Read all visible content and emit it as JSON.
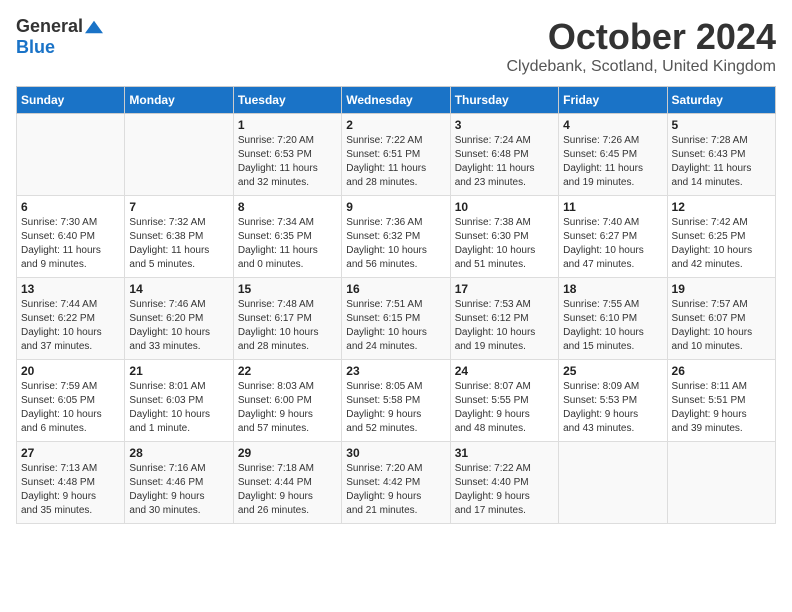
{
  "header": {
    "logo_general": "General",
    "logo_blue": "Blue",
    "month_title": "October 2024",
    "location": "Clydebank, Scotland, United Kingdom"
  },
  "days_of_week": [
    "Sunday",
    "Monday",
    "Tuesday",
    "Wednesday",
    "Thursday",
    "Friday",
    "Saturday"
  ],
  "weeks": [
    [
      {
        "day": "",
        "info": ""
      },
      {
        "day": "",
        "info": ""
      },
      {
        "day": "1",
        "info": "Sunrise: 7:20 AM\nSunset: 6:53 PM\nDaylight: 11 hours\nand 32 minutes."
      },
      {
        "day": "2",
        "info": "Sunrise: 7:22 AM\nSunset: 6:51 PM\nDaylight: 11 hours\nand 28 minutes."
      },
      {
        "day": "3",
        "info": "Sunrise: 7:24 AM\nSunset: 6:48 PM\nDaylight: 11 hours\nand 23 minutes."
      },
      {
        "day": "4",
        "info": "Sunrise: 7:26 AM\nSunset: 6:45 PM\nDaylight: 11 hours\nand 19 minutes."
      },
      {
        "day": "5",
        "info": "Sunrise: 7:28 AM\nSunset: 6:43 PM\nDaylight: 11 hours\nand 14 minutes."
      }
    ],
    [
      {
        "day": "6",
        "info": "Sunrise: 7:30 AM\nSunset: 6:40 PM\nDaylight: 11 hours\nand 9 minutes."
      },
      {
        "day": "7",
        "info": "Sunrise: 7:32 AM\nSunset: 6:38 PM\nDaylight: 11 hours\nand 5 minutes."
      },
      {
        "day": "8",
        "info": "Sunrise: 7:34 AM\nSunset: 6:35 PM\nDaylight: 11 hours\nand 0 minutes."
      },
      {
        "day": "9",
        "info": "Sunrise: 7:36 AM\nSunset: 6:32 PM\nDaylight: 10 hours\nand 56 minutes."
      },
      {
        "day": "10",
        "info": "Sunrise: 7:38 AM\nSunset: 6:30 PM\nDaylight: 10 hours\nand 51 minutes."
      },
      {
        "day": "11",
        "info": "Sunrise: 7:40 AM\nSunset: 6:27 PM\nDaylight: 10 hours\nand 47 minutes."
      },
      {
        "day": "12",
        "info": "Sunrise: 7:42 AM\nSunset: 6:25 PM\nDaylight: 10 hours\nand 42 minutes."
      }
    ],
    [
      {
        "day": "13",
        "info": "Sunrise: 7:44 AM\nSunset: 6:22 PM\nDaylight: 10 hours\nand 37 minutes."
      },
      {
        "day": "14",
        "info": "Sunrise: 7:46 AM\nSunset: 6:20 PM\nDaylight: 10 hours\nand 33 minutes."
      },
      {
        "day": "15",
        "info": "Sunrise: 7:48 AM\nSunset: 6:17 PM\nDaylight: 10 hours\nand 28 minutes."
      },
      {
        "day": "16",
        "info": "Sunrise: 7:51 AM\nSunset: 6:15 PM\nDaylight: 10 hours\nand 24 minutes."
      },
      {
        "day": "17",
        "info": "Sunrise: 7:53 AM\nSunset: 6:12 PM\nDaylight: 10 hours\nand 19 minutes."
      },
      {
        "day": "18",
        "info": "Sunrise: 7:55 AM\nSunset: 6:10 PM\nDaylight: 10 hours\nand 15 minutes."
      },
      {
        "day": "19",
        "info": "Sunrise: 7:57 AM\nSunset: 6:07 PM\nDaylight: 10 hours\nand 10 minutes."
      }
    ],
    [
      {
        "day": "20",
        "info": "Sunrise: 7:59 AM\nSunset: 6:05 PM\nDaylight: 10 hours\nand 6 minutes."
      },
      {
        "day": "21",
        "info": "Sunrise: 8:01 AM\nSunset: 6:03 PM\nDaylight: 10 hours\nand 1 minute."
      },
      {
        "day": "22",
        "info": "Sunrise: 8:03 AM\nSunset: 6:00 PM\nDaylight: 9 hours\nand 57 minutes."
      },
      {
        "day": "23",
        "info": "Sunrise: 8:05 AM\nSunset: 5:58 PM\nDaylight: 9 hours\nand 52 minutes."
      },
      {
        "day": "24",
        "info": "Sunrise: 8:07 AM\nSunset: 5:55 PM\nDaylight: 9 hours\nand 48 minutes."
      },
      {
        "day": "25",
        "info": "Sunrise: 8:09 AM\nSunset: 5:53 PM\nDaylight: 9 hours\nand 43 minutes."
      },
      {
        "day": "26",
        "info": "Sunrise: 8:11 AM\nSunset: 5:51 PM\nDaylight: 9 hours\nand 39 minutes."
      }
    ],
    [
      {
        "day": "27",
        "info": "Sunrise: 7:13 AM\nSunset: 4:48 PM\nDaylight: 9 hours\nand 35 minutes."
      },
      {
        "day": "28",
        "info": "Sunrise: 7:16 AM\nSunset: 4:46 PM\nDaylight: 9 hours\nand 30 minutes."
      },
      {
        "day": "29",
        "info": "Sunrise: 7:18 AM\nSunset: 4:44 PM\nDaylight: 9 hours\nand 26 minutes."
      },
      {
        "day": "30",
        "info": "Sunrise: 7:20 AM\nSunset: 4:42 PM\nDaylight: 9 hours\nand 21 minutes."
      },
      {
        "day": "31",
        "info": "Sunrise: 7:22 AM\nSunset: 4:40 PM\nDaylight: 9 hours\nand 17 minutes."
      },
      {
        "day": "",
        "info": ""
      },
      {
        "day": "",
        "info": ""
      }
    ]
  ]
}
